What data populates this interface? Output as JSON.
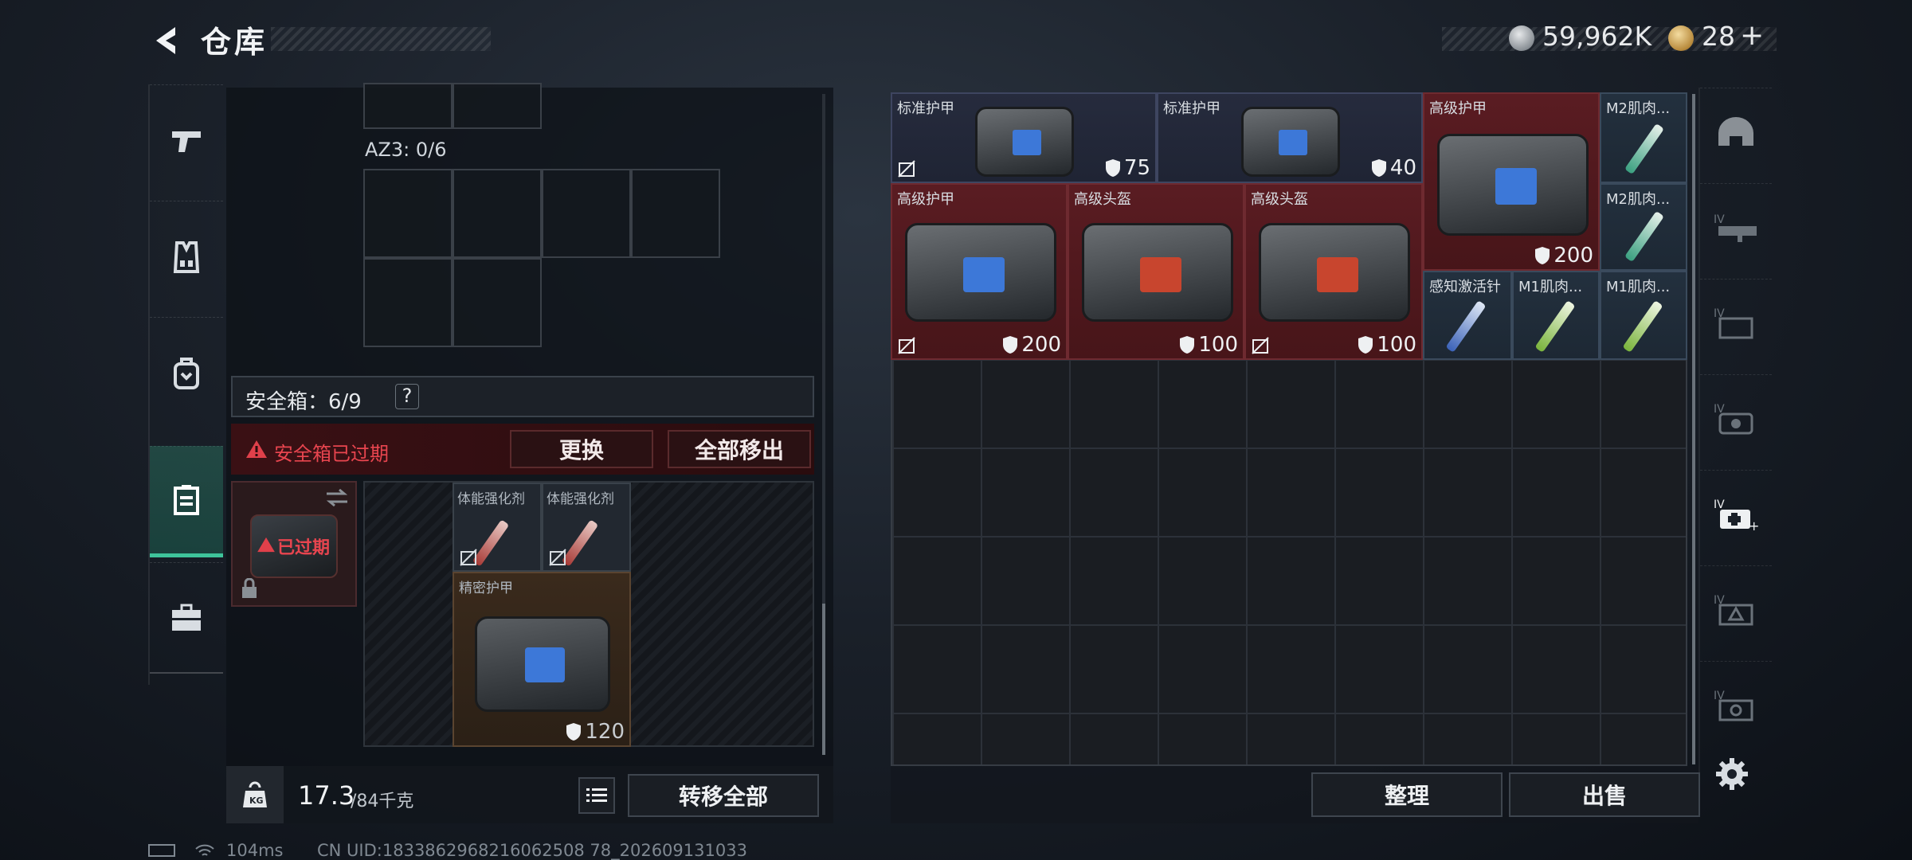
{
  "header": {
    "title": "仓库",
    "currency_silver": "59,962K",
    "currency_gold": "28",
    "gold_plus": "+"
  },
  "left": {
    "az_label": "AZ3: 0/6",
    "safebox_label": "安全箱：6/9",
    "safebox_help": "?",
    "expired_warning": "安全箱已过期",
    "replace_btn": "更换",
    "remove_all_btn": "全部移出",
    "expired_tag": "已过期",
    "items": [
      {
        "name": "体能强化剂"
      },
      {
        "name": "体能强化剂"
      },
      {
        "name": "精密护甲",
        "durability": "120"
      }
    ],
    "weight_value": "17.3",
    "weight_max": "/84千克",
    "transfer_all_btn": "转移全部"
  },
  "storage": {
    "items": [
      {
        "name": "标准护甲",
        "durability": "75"
      },
      {
        "name": "标准护甲",
        "durability": "40"
      },
      {
        "name": "高级护甲",
        "durability": "200"
      },
      {
        "name": "M2肌肉..."
      },
      {
        "name": "M2肌肉..."
      },
      {
        "name": "高级护甲",
        "durability": "200"
      },
      {
        "name": "高级头盔",
        "durability": "100"
      },
      {
        "name": "高级头盔",
        "durability": "100"
      },
      {
        "name": "感知激活针"
      },
      {
        "name": "M1肌肉..."
      },
      {
        "name": "M1肌肉..."
      }
    ],
    "sort_btn": "整理",
    "sell_btn": "出售"
  },
  "status": {
    "ping": "104ms",
    "uid": "CN UID:1833862968216062508 78_202609131033"
  },
  "icons": {
    "back": "back-arrow-icon",
    "silver": "silver-coin-icon",
    "gold": "gold-coin-icon",
    "nav": [
      "pistol-icon",
      "vest-icon",
      "backpack-icon",
      "safebox-icon",
      "briefcase-icon"
    ],
    "right": [
      "helmet-icon",
      "rifle-icon",
      "ammo-icon",
      "gear-icon",
      "medkit-icon",
      "tool-icon",
      "misc-icon",
      "settings-icon"
    ]
  },
  "colors": {
    "accent_green": "#3ec39a",
    "warning_red": "#e0404a",
    "rare_red": "#5a1c22",
    "common_blue": "#262b3d"
  }
}
